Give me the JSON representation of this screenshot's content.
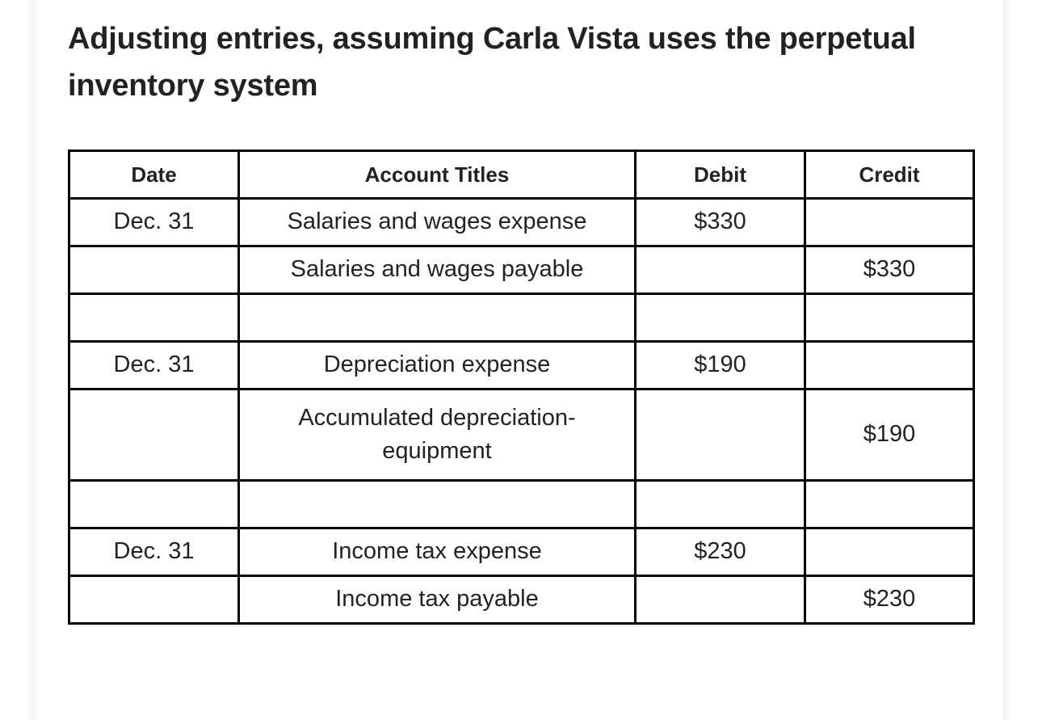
{
  "page": {
    "title_line1": "Adjusting entries, assuming Carla Vista uses the",
    "title_line2": "perpetual inventory system",
    "text_color": "#222222",
    "border_color": "#000000",
    "background": "#ffffff"
  },
  "table": {
    "headers": {
      "date": "Date",
      "account_titles": "Account Titles",
      "debit": "Debit",
      "credit": "Credit"
    },
    "rows": [
      {
        "date": "Dec. 31",
        "account": "Salaries and wages expense",
        "debit": "$330",
        "credit": "",
        "kind": "entry"
      },
      {
        "date": "",
        "account": "Salaries and wages payable",
        "debit": "",
        "credit": "$330",
        "kind": "entry"
      },
      {
        "date": "",
        "account": "",
        "debit": "",
        "credit": "",
        "kind": "spacer"
      },
      {
        "date": "Dec. 31",
        "account": "Depreciation expense",
        "debit": "$190",
        "credit": "",
        "kind": "entry"
      },
      {
        "date": "",
        "account": "Accumulated depreciation-equipment",
        "debit": "",
        "credit": "$190",
        "kind": "tall"
      },
      {
        "date": "",
        "account": "",
        "debit": "",
        "credit": "",
        "kind": "spacer"
      },
      {
        "date": "Dec. 31",
        "account": "Income tax expense",
        "debit": "$230",
        "credit": "",
        "kind": "entry"
      },
      {
        "date": "",
        "account": "Income tax payable",
        "debit": "",
        "credit": "$230",
        "kind": "entry"
      }
    ]
  }
}
